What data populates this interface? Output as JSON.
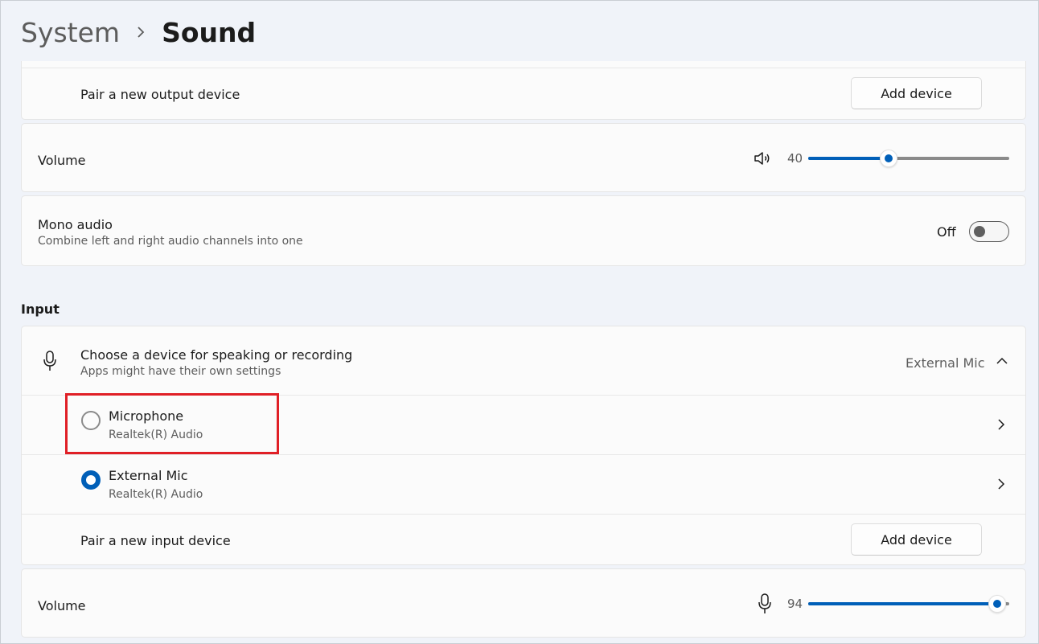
{
  "header": {
    "parent": "System",
    "current": "Sound"
  },
  "output": {
    "pair_label": "Pair a new output device",
    "add_button": "Add device",
    "volume_label": "Volume",
    "volume_value": "40",
    "volume_level": 40,
    "mono_label": "Mono audio",
    "mono_desc": "Combine left and right audio channels into one",
    "mono_state": "Off"
  },
  "input": {
    "section_title": "Input",
    "choose_label": "Choose a device for speaking or recording",
    "choose_desc": "Apps might have their own settings",
    "selected_device": "External Mic",
    "devices": [
      {
        "name": "Microphone",
        "detail": "Realtek(R) Audio",
        "selected": false
      },
      {
        "name": "External Mic",
        "detail": "Realtek(R) Audio",
        "selected": true
      }
    ],
    "pair_label": "Pair a new input device",
    "add_button": "Add device",
    "volume_label": "Volume",
    "volume_value": "94",
    "volume_level": 94
  },
  "icons": [
    "chevron-right-icon",
    "speaker-icon",
    "microphone-icon",
    "chevron-up-icon"
  ],
  "colors": {
    "accent": "#005fb8",
    "highlight": "#e01f26",
    "background": "#f0f3f9"
  }
}
